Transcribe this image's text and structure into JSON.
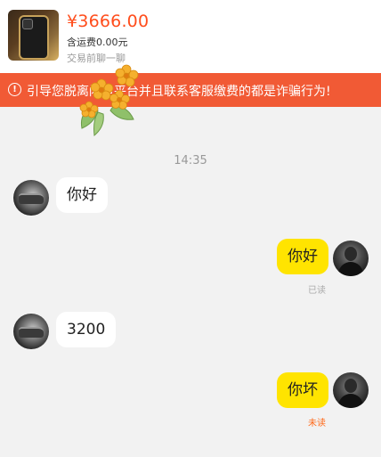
{
  "header": {
    "product_thumbnail_icon": "phone-product-icon",
    "price": "¥3666.00",
    "shipping": "含运费0.00元",
    "trade_link": "交易前聊一聊"
  },
  "warning": {
    "icon": "exclamation-circle-icon",
    "text": "引导您脱离闲鱼平台并且联系客服缴费的都是诈骗行为!",
    "background": "#f15a35"
  },
  "sticker": {
    "icon": "osmanthus-flower-sticker"
  },
  "chat": {
    "timestamp": "14:35",
    "messages": [
      {
        "side": "left",
        "text": "你好"
      },
      {
        "side": "right",
        "text": "你好",
        "status": "已读"
      },
      {
        "side": "left",
        "text": "3200"
      },
      {
        "side": "right",
        "text": "你坏",
        "status": "未读"
      }
    ]
  },
  "colors": {
    "accent_price": "#ff4d1c",
    "my_bubble": "#ffe400",
    "unread": "#ff6a1a"
  }
}
